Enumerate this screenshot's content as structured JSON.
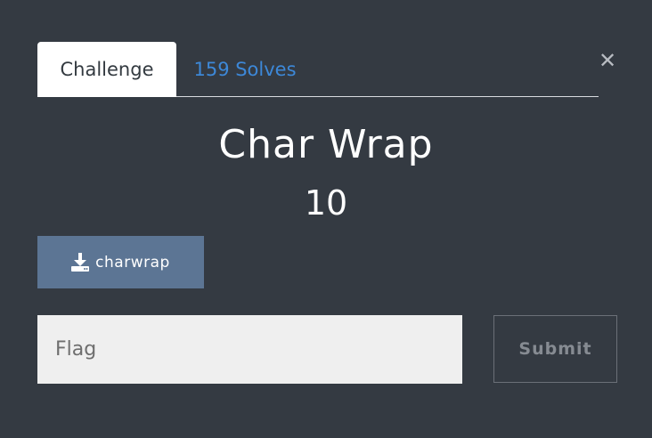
{
  "tabs": [
    {
      "label": "Challenge",
      "active": true
    },
    {
      "label": "159 Solves",
      "active": false
    }
  ],
  "close": {
    "icon": "close-icon",
    "glyph": "✕"
  },
  "challenge": {
    "name": "Char Wrap",
    "value": "10"
  },
  "download": {
    "label": "charwrap",
    "icon": "download-icon"
  },
  "flag": {
    "placeholder": "Flag",
    "value": ""
  },
  "submit": {
    "label": "Submit"
  },
  "colors": {
    "background": "#343a42",
    "accent_link": "#3d88d8",
    "download_button": "#5c7594",
    "input_bg": "#efefef"
  }
}
